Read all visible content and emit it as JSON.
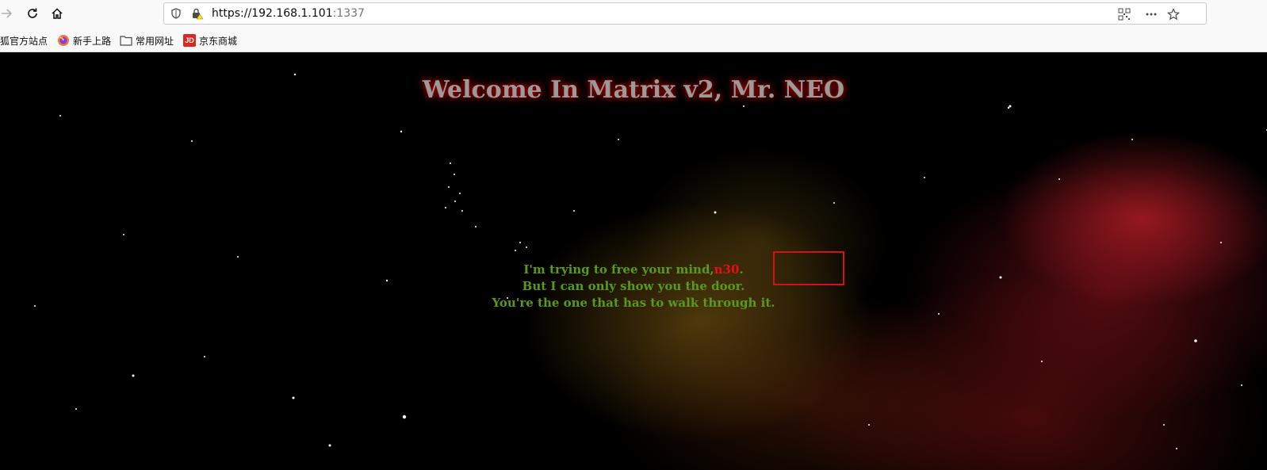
{
  "browser": {
    "url_host": "https://192.168.1.101",
    "url_port": ":1337"
  },
  "bookmarks": [
    {
      "label": "狐官方站点",
      "icon": "none"
    },
    {
      "label": "新手上路",
      "icon": "firefox-icon"
    },
    {
      "label": "常用网址",
      "icon": "folder-icon"
    },
    {
      "label": "京东商城",
      "icon": "jd-icon",
      "icon_text": "JD"
    }
  ],
  "page": {
    "title": "Welcome In Matrix v2, Mr. NEO",
    "message": {
      "line1_before": "I'm trying to free your mind,",
      "line1_highlight": "n30",
      "line1_after": ".",
      "line2": "But I can only show you the door.",
      "line3": "You're the one that has to walk through it."
    }
  },
  "colors": {
    "message_text": "#5a9a1a",
    "highlight_text": "#e81010",
    "annotation_box": "#d81010",
    "title_glow": "#c00000"
  }
}
